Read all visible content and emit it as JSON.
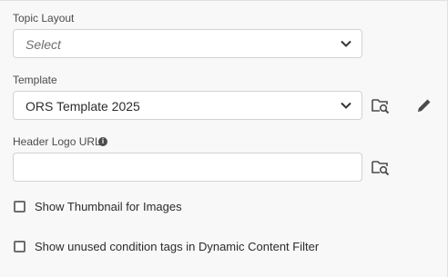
{
  "topic_layout": {
    "label": "Topic Layout",
    "placeholder": "Select"
  },
  "template": {
    "label": "Template",
    "value": "ORS Template 2025"
  },
  "header_logo": {
    "label": "Header Logo URL",
    "info": "i",
    "value": ""
  },
  "options": [
    {
      "label": "Show Thumbnail for Images",
      "checked": false
    },
    {
      "label": "Show unused condition tags in Dynamic Content Filter",
      "checked": false
    }
  ],
  "icons": {
    "dropdown": "chevron-down-icon",
    "browse": "folder-search-icon",
    "edit": "pencil-icon",
    "info": "info-icon"
  },
  "colors": {
    "background": "#f8f8f8",
    "field_border": "#d3d3d3",
    "icon": "#4b4b4b"
  }
}
